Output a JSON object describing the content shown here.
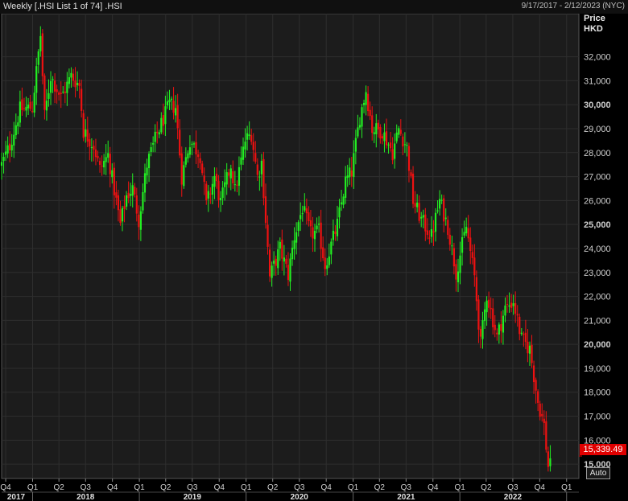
{
  "header": {
    "title": "Weekly [.HSI List 1 of 74] .HSI",
    "date_range": "9/17/2017 - 2/12/2023 (NYC)"
  },
  "price_axis": {
    "title": "Price",
    "unit": "HKD"
  },
  "current_price": "15,339.49",
  "auto_button": "Auto",
  "colors": {
    "up": "#22ee22",
    "down": "#ee1111",
    "background": "#000000",
    "plot": "#1c1c1c",
    "grid": "#2e2e2e"
  },
  "chart_data": {
    "type": "candlestick",
    "x_start": "2017-09-17",
    "x_end": "2023-02-12",
    "ylim": [
      14400,
      33800
    ],
    "y_ticks": [
      {
        "value": 15000,
        "label": "15,000",
        "bold": true
      },
      {
        "value": 16000,
        "label": "16,000",
        "bold": false
      },
      {
        "value": 17000,
        "label": "17,000",
        "bold": false
      },
      {
        "value": 18000,
        "label": "18,000",
        "bold": false
      },
      {
        "value": 19000,
        "label": "19,000",
        "bold": false
      },
      {
        "value": 20000,
        "label": "20,000",
        "bold": true
      },
      {
        "value": 21000,
        "label": "21,000",
        "bold": false
      },
      {
        "value": 22000,
        "label": "22,000",
        "bold": false
      },
      {
        "value": 23000,
        "label": "23,000",
        "bold": false
      },
      {
        "value": 24000,
        "label": "24,000",
        "bold": false
      },
      {
        "value": 25000,
        "label": "25,000",
        "bold": true
      },
      {
        "value": 26000,
        "label": "26,000",
        "bold": false
      },
      {
        "value": 27000,
        "label": "27,000",
        "bold": false
      },
      {
        "value": 28000,
        "label": "28,000",
        "bold": false
      },
      {
        "value": 29000,
        "label": "29,000",
        "bold": false
      },
      {
        "value": 30000,
        "label": "30,000",
        "bold": true
      },
      {
        "value": 31000,
        "label": "31,000",
        "bold": false
      },
      {
        "value": 32000,
        "label": "32,000",
        "bold": false
      }
    ],
    "quarter_ticks": [
      {
        "date": "2017-10-01",
        "label": "Q4"
      },
      {
        "date": "2018-01-01",
        "label": "Q1"
      },
      {
        "date": "2018-04-01",
        "label": "Q2"
      },
      {
        "date": "2018-07-01",
        "label": "Q3"
      },
      {
        "date": "2018-10-01",
        "label": "Q4"
      },
      {
        "date": "2019-01-01",
        "label": "Q1"
      },
      {
        "date": "2019-04-01",
        "label": "Q2"
      },
      {
        "date": "2019-07-01",
        "label": "Q3"
      },
      {
        "date": "2019-10-01",
        "label": "Q4"
      },
      {
        "date": "2020-01-01",
        "label": "Q1"
      },
      {
        "date": "2020-04-01",
        "label": "Q2"
      },
      {
        "date": "2020-07-01",
        "label": "Q3"
      },
      {
        "date": "2020-10-01",
        "label": "Q4"
      },
      {
        "date": "2021-01-01",
        "label": "Q1"
      },
      {
        "date": "2021-04-01",
        "label": "Q2"
      },
      {
        "date": "2021-07-01",
        "label": "Q3"
      },
      {
        "date": "2021-10-01",
        "label": "Q4"
      },
      {
        "date": "2022-01-01",
        "label": "Q1"
      },
      {
        "date": "2022-04-01",
        "label": "Q2"
      },
      {
        "date": "2022-07-01",
        "label": "Q3"
      },
      {
        "date": "2022-10-01",
        "label": "Q4"
      },
      {
        "date": "2023-01-01",
        "label": "Q1"
      }
    ],
    "year_labels": [
      {
        "date": "2017-11-01",
        "label": "2017"
      },
      {
        "date": "2018-07-01",
        "label": "2018"
      },
      {
        "date": "2019-07-01",
        "label": "2019"
      },
      {
        "date": "2020-07-01",
        "label": "2020"
      },
      {
        "date": "2021-07-01",
        "label": "2021"
      },
      {
        "date": "2022-07-01",
        "label": "2022"
      }
    ],
    "anchors": [
      {
        "date": "2017-09-17",
        "price": 27500
      },
      {
        "date": "2017-10-15",
        "price": 28300
      },
      {
        "date": "2017-11-19",
        "price": 29800
      },
      {
        "date": "2017-12-31",
        "price": 29900
      },
      {
        "date": "2018-01-28",
        "price": 32900
      },
      {
        "date": "2018-02-11",
        "price": 29500
      },
      {
        "date": "2018-03-04",
        "price": 31200
      },
      {
        "date": "2018-04-08",
        "price": 30300
      },
      {
        "date": "2018-05-13",
        "price": 31200
      },
      {
        "date": "2018-06-10",
        "price": 30800
      },
      {
        "date": "2018-06-24",
        "price": 28900
      },
      {
        "date": "2018-07-29",
        "price": 28300
      },
      {
        "date": "2018-08-19",
        "price": 27300
      },
      {
        "date": "2018-09-16",
        "price": 27900
      },
      {
        "date": "2018-10-28",
        "price": 25000
      },
      {
        "date": "2018-11-18",
        "price": 26200
      },
      {
        "date": "2018-12-09",
        "price": 26500
      },
      {
        "date": "2018-12-30",
        "price": 25200
      },
      {
        "date": "2019-01-27",
        "price": 27500
      },
      {
        "date": "2019-03-03",
        "price": 28800
      },
      {
        "date": "2019-04-14",
        "price": 30000
      },
      {
        "date": "2019-05-05",
        "price": 29900
      },
      {
        "date": "2019-05-26",
        "price": 27000
      },
      {
        "date": "2019-06-23",
        "price": 28500
      },
      {
        "date": "2019-07-28",
        "price": 27900
      },
      {
        "date": "2019-08-18",
        "price": 25800
      },
      {
        "date": "2019-09-15",
        "price": 27000
      },
      {
        "date": "2019-10-06",
        "price": 25900
      },
      {
        "date": "2019-11-10",
        "price": 27500
      },
      {
        "date": "2019-11-24",
        "price": 26400
      },
      {
        "date": "2019-12-29",
        "price": 28500
      },
      {
        "date": "2020-01-19",
        "price": 28800
      },
      {
        "date": "2020-02-09",
        "price": 27000
      },
      {
        "date": "2020-02-23",
        "price": 27600
      },
      {
        "date": "2020-03-22",
        "price": 22800
      },
      {
        "date": "2020-04-26",
        "price": 24000
      },
      {
        "date": "2020-05-24",
        "price": 22900
      },
      {
        "date": "2020-06-14",
        "price": 24500
      },
      {
        "date": "2020-07-12",
        "price": 25700
      },
      {
        "date": "2020-08-09",
        "price": 24600
      },
      {
        "date": "2020-09-06",
        "price": 24700
      },
      {
        "date": "2020-09-27",
        "price": 23300
      },
      {
        "date": "2020-11-08",
        "price": 25000
      },
      {
        "date": "2020-12-06",
        "price": 26800
      },
      {
        "date": "2020-12-27",
        "price": 27200
      },
      {
        "date": "2021-01-24",
        "price": 29500
      },
      {
        "date": "2021-02-14",
        "price": 30600
      },
      {
        "date": "2021-03-07",
        "price": 29000
      },
      {
        "date": "2021-04-11",
        "price": 28900
      },
      {
        "date": "2021-05-16",
        "price": 28000
      },
      {
        "date": "2021-06-06",
        "price": 29000
      },
      {
        "date": "2021-07-04",
        "price": 28200
      },
      {
        "date": "2021-07-25",
        "price": 26000
      },
      {
        "date": "2021-08-22",
        "price": 25200
      },
      {
        "date": "2021-09-26",
        "price": 24500
      },
      {
        "date": "2021-10-24",
        "price": 26000
      },
      {
        "date": "2021-11-21",
        "price": 24900
      },
      {
        "date": "2021-12-19",
        "price": 23000
      },
      {
        "date": "2022-01-23",
        "price": 24900
      },
      {
        "date": "2022-02-20",
        "price": 22800
      },
      {
        "date": "2022-03-13",
        "price": 20000
      },
      {
        "date": "2022-04-03",
        "price": 22100
      },
      {
        "date": "2022-05-08",
        "price": 20300
      },
      {
        "date": "2022-06-05",
        "price": 21500
      },
      {
        "date": "2022-07-03",
        "price": 21800
      },
      {
        "date": "2022-07-31",
        "price": 20200
      },
      {
        "date": "2022-08-28",
        "price": 19800
      },
      {
        "date": "2022-09-25",
        "price": 17600
      },
      {
        "date": "2022-10-16",
        "price": 16600
      },
      {
        "date": "2022-10-30",
        "price": 14900
      },
      {
        "date": "2022-11-06",
        "price": 15339
      }
    ]
  }
}
